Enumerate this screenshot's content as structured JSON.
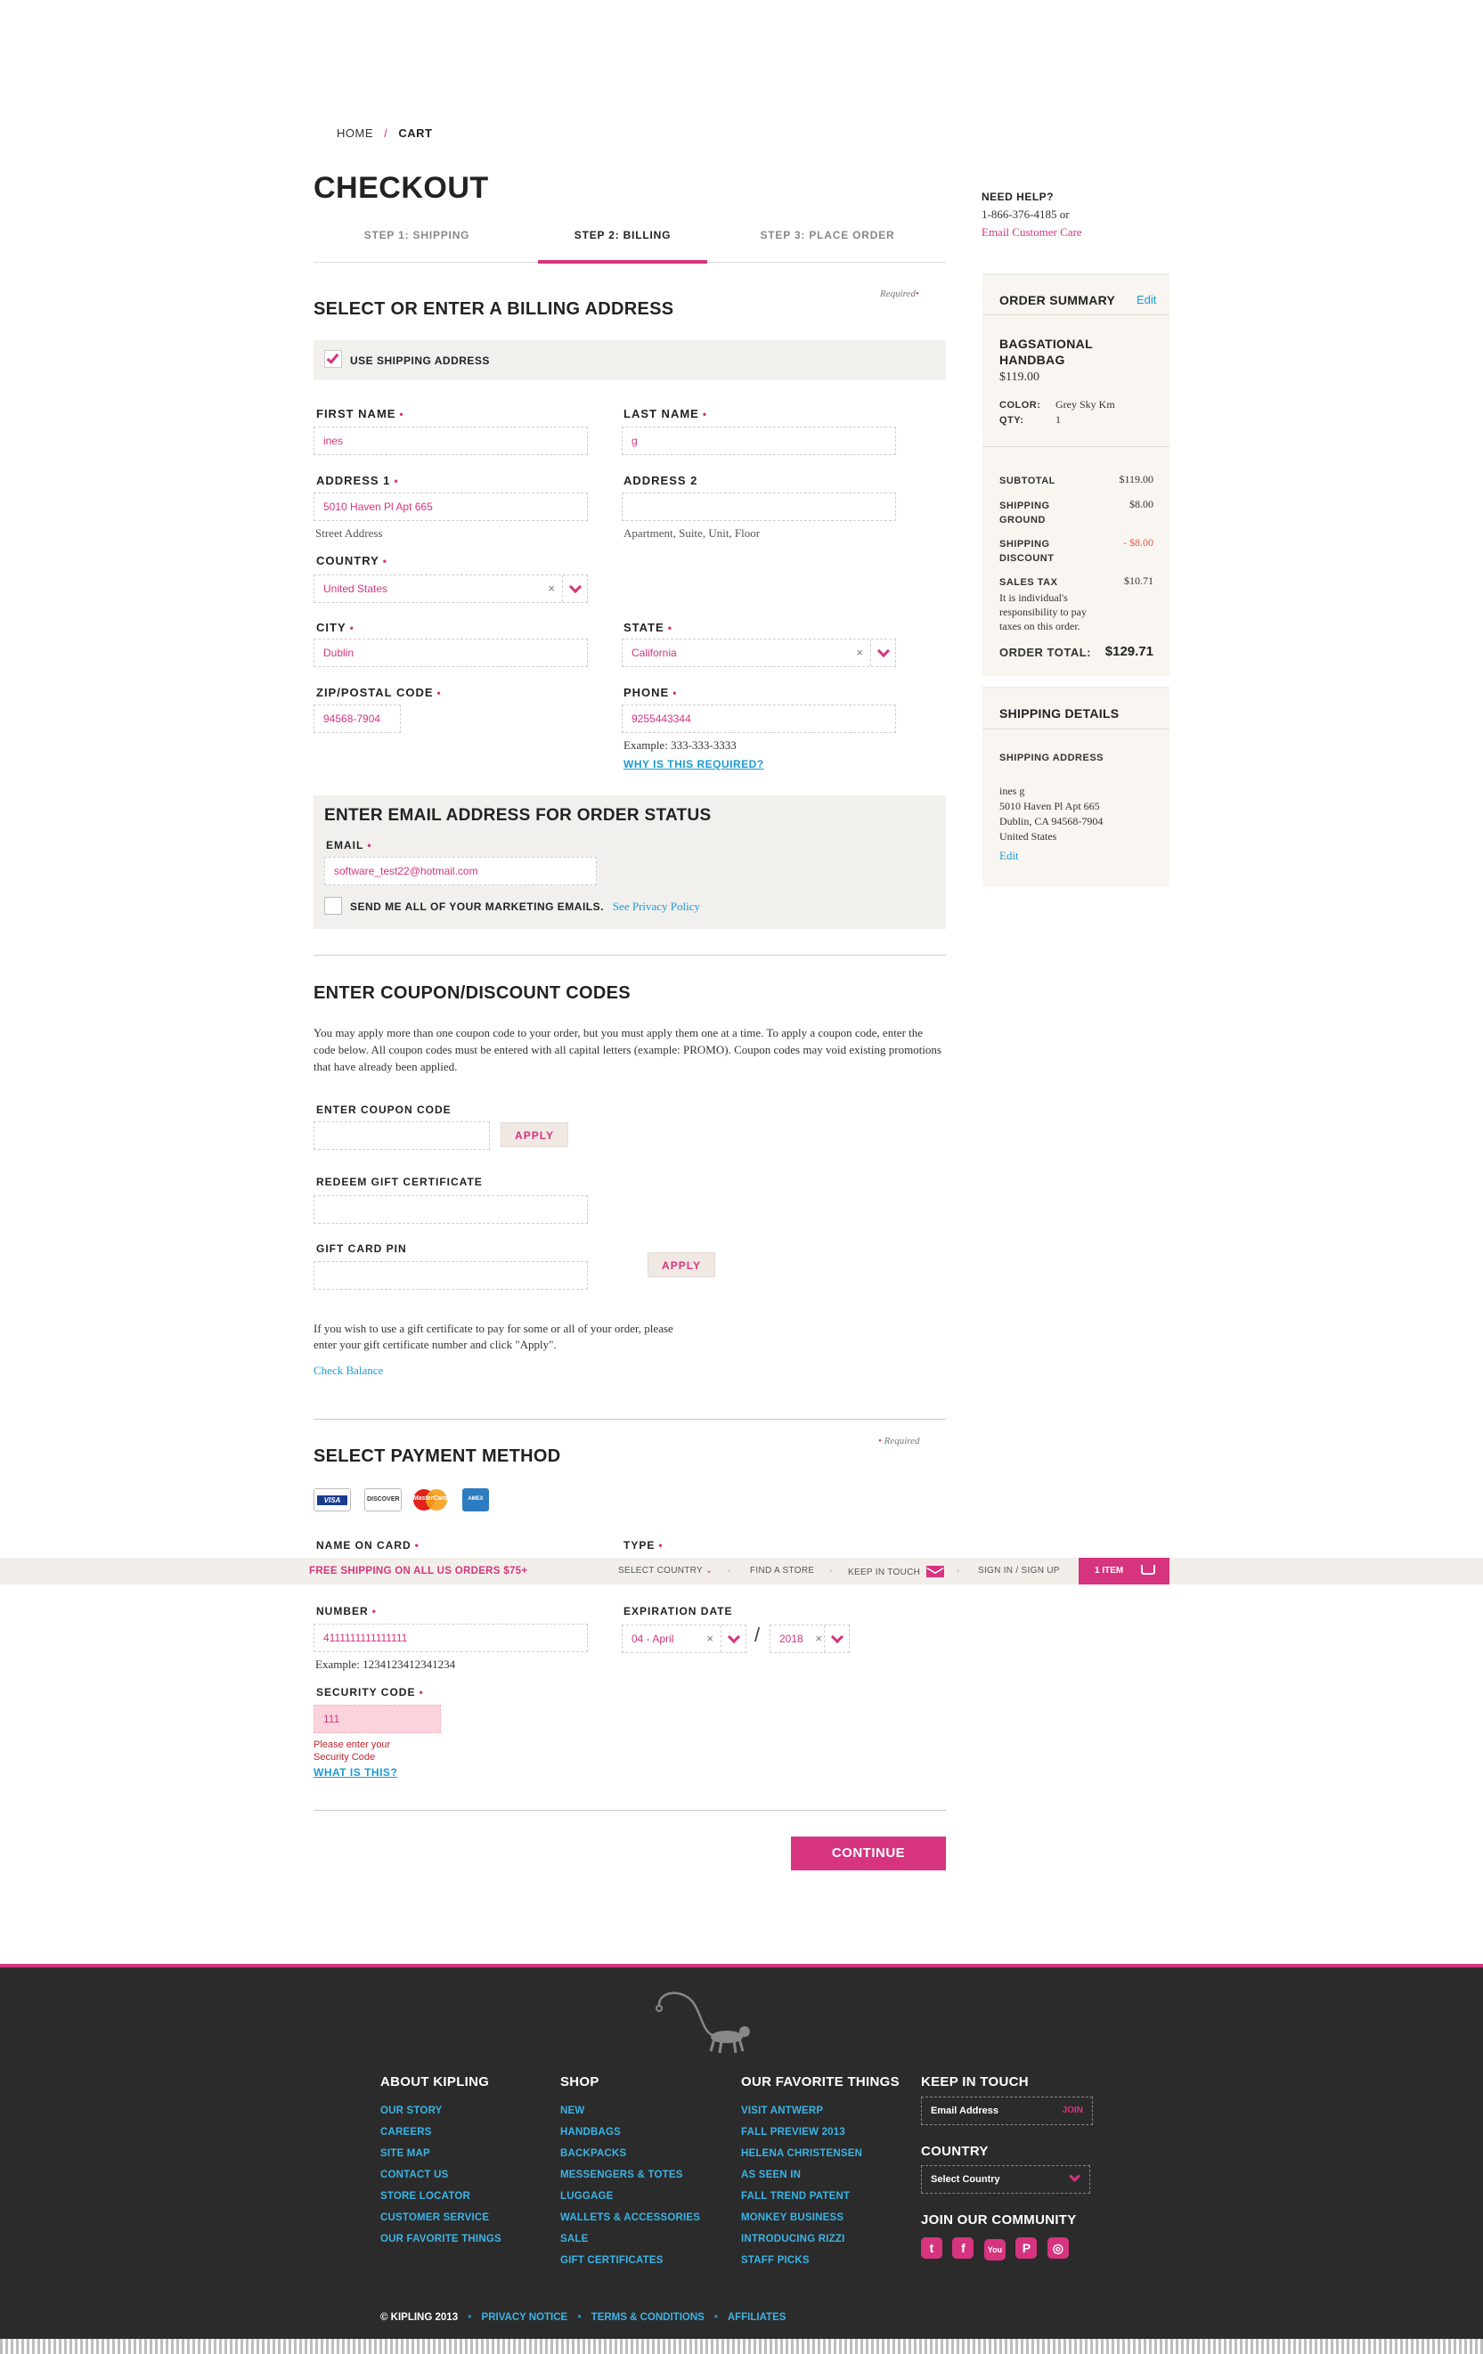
{
  "breadcrumb": {
    "home": "HOME",
    "sep": "/",
    "current": "CART"
  },
  "page_title": "CHECKOUT",
  "steps": [
    "STEP 1: SHIPPING",
    "STEP 2: BILLING",
    "STEP 3: PLACE ORDER"
  ],
  "active_step": 1,
  "help": {
    "title": "NEED HELP?",
    "phone": "1-866-376-4185 or",
    "link": "Email Customer Care"
  },
  "billing": {
    "title": "SELECT OR ENTER A BILLING ADDRESS",
    "required": "Required",
    "use_shipping": "USE SHIPPING ADDRESS",
    "first_name_label": "FIRST NAME",
    "first_name": "ines",
    "last_name_label": "LAST NAME",
    "last_name": "g",
    "address1_label": "ADDRESS 1",
    "address1": "5010 Haven Pl Apt 665",
    "address1_hint": "Street Address",
    "address2_label": "ADDRESS 2",
    "address2": "",
    "address2_hint": "Apartment, Suite, Unit, Floor",
    "country_label": "COUNTRY",
    "country": "United States",
    "city_label": "CITY",
    "city": "Dublin",
    "state_label": "STATE",
    "state": "California",
    "zip_label": "ZIP/POSTAL CODE",
    "zip": "94568-7904",
    "phone_label": "PHONE",
    "phone": "9255443344",
    "phone_example": "Example: 333-333-3333",
    "phone_why": "WHY IS THIS REQUIRED?"
  },
  "email_section": {
    "title": "ENTER EMAIL ADDRESS FOR ORDER STATUS",
    "email_label": "EMAIL",
    "email": "software_test22@hotmail.com",
    "marketing": "SEND ME ALL OF YOUR MARKETING EMAILS.",
    "privacy": "See Privacy Policy"
  },
  "coupon": {
    "title": "ENTER COUPON/DISCOUNT CODES",
    "desc": "You may apply more than one coupon code  to your order, but you must apply them one at a time.  To apply a coupon code, enter the code below.  All coupon codes must be entered with all capital letters (example: PROMO). Coupon codes may void existing promotions that have already been applied.",
    "coupon_label": "ENTER COUPON CODE",
    "apply": "APPLY",
    "gift_label": "REDEEM GIFT CERTIFICATE",
    "pin_label": "GIFT CARD PIN",
    "gift_note": "If you wish to use a gift certificate to pay for some or all of your order, please enter your gift certificate number and click \"Apply\".",
    "check_balance": "Check Balance"
  },
  "payment": {
    "title": "SELECT PAYMENT METHOD",
    "required": "Required",
    "cards": [
      "VISA",
      "DISCOVER",
      "MasterCard",
      "AMEX"
    ],
    "name_label": "NAME ON CARD",
    "type_label": "TYPE",
    "number_label": "NUMBER",
    "number": "4111111111111111",
    "number_example": "Example: 1234123412341234",
    "exp_label": "EXPIRATION DATE",
    "exp_month": "04 - April",
    "exp_year": "2018",
    "cvv_label": "SECURITY CODE",
    "cvv": "111",
    "cvv_error": "Please enter your Security Code",
    "cvv_what": "WHAT IS THIS?",
    "continue": "CONTINUE"
  },
  "promo_bar": {
    "free_shipping": "FREE SHIPPING ON ALL US ORDERS $75+",
    "select_country": "SELECT COUNTRY",
    "find_store": "FIND A STORE",
    "keep_in_touch": "KEEP IN TOUCH",
    "signin": "SIGN IN / SIGN UP",
    "cart": "1 ITEM"
  },
  "order_summary": {
    "title": "ORDER SUMMARY",
    "edit": "Edit",
    "product": "BAGSATIONAL HANDBAG",
    "price": "$119.00",
    "color_label": "COLOR:",
    "color": "Grey Sky Km",
    "qty_label": "QTY:",
    "qty": "1",
    "subtotal_label": "SUBTOTAL",
    "subtotal": "$119.00",
    "shipping_label": "SHIPPING GROUND",
    "shipping": "$8.00",
    "discount_label": "SHIPPING DISCOUNT",
    "discount": "- $8.00",
    "tax_label": "SALES TAX",
    "tax": "$10.71",
    "tax_note": "It is individual's responsibility to pay taxes on this order.",
    "total_label": "ORDER TOTAL:",
    "total": "$129.71"
  },
  "shipping_details": {
    "title": "SHIPPING DETAILS",
    "addr_label": "SHIPPING ADDRESS",
    "name": "ines g",
    "line1": "5010 Haven Pl Apt 665",
    "line2": "Dublin, CA 94568-7904",
    "line3": "United States",
    "edit": "Edit"
  },
  "footer": {
    "about": {
      "title": "ABOUT KIPLING",
      "links": [
        "OUR STORY",
        "CAREERS",
        "SITE MAP",
        "CONTACT US",
        "STORE LOCATOR",
        "CUSTOMER SERVICE",
        "OUR FAVORITE THINGS"
      ]
    },
    "shop": {
      "title": "SHOP",
      "links": [
        "NEW",
        "HANDBAGS",
        "BACKPACKS",
        "MESSENGERS & TOTES",
        "LUGGAGE",
        "WALLETS & ACCESSORIES",
        "SALE",
        "GIFT CERTIFICATES"
      ]
    },
    "fav": {
      "title": "OUR FAVORITE THINGS",
      "links": [
        "VISIT ANTWERP",
        "FALL PREVIEW 2013",
        "HELENA CHRISTENSEN",
        "AS SEEN IN",
        "FALL TREND PATENT",
        "MONKEY BUSINESS",
        "INTRODUCING RIZZI",
        "STAFF PICKS"
      ]
    },
    "touch": {
      "title": "KEEP IN TOUCH",
      "email_placeholder": "Email Address",
      "join": "JOIN",
      "country_title": "COUNTRY",
      "country_select": "Select Country",
      "community": "JOIN OUR COMMUNITY",
      "socials": [
        "t",
        "f",
        "You",
        "P",
        "◎"
      ]
    },
    "legal": {
      "copy": "© KIPLING 2013",
      "privacy": "PRIVACY NOTICE",
      "terms": "TERMS & CONDITIONS",
      "affiliates": "AFFILIATES"
    }
  }
}
